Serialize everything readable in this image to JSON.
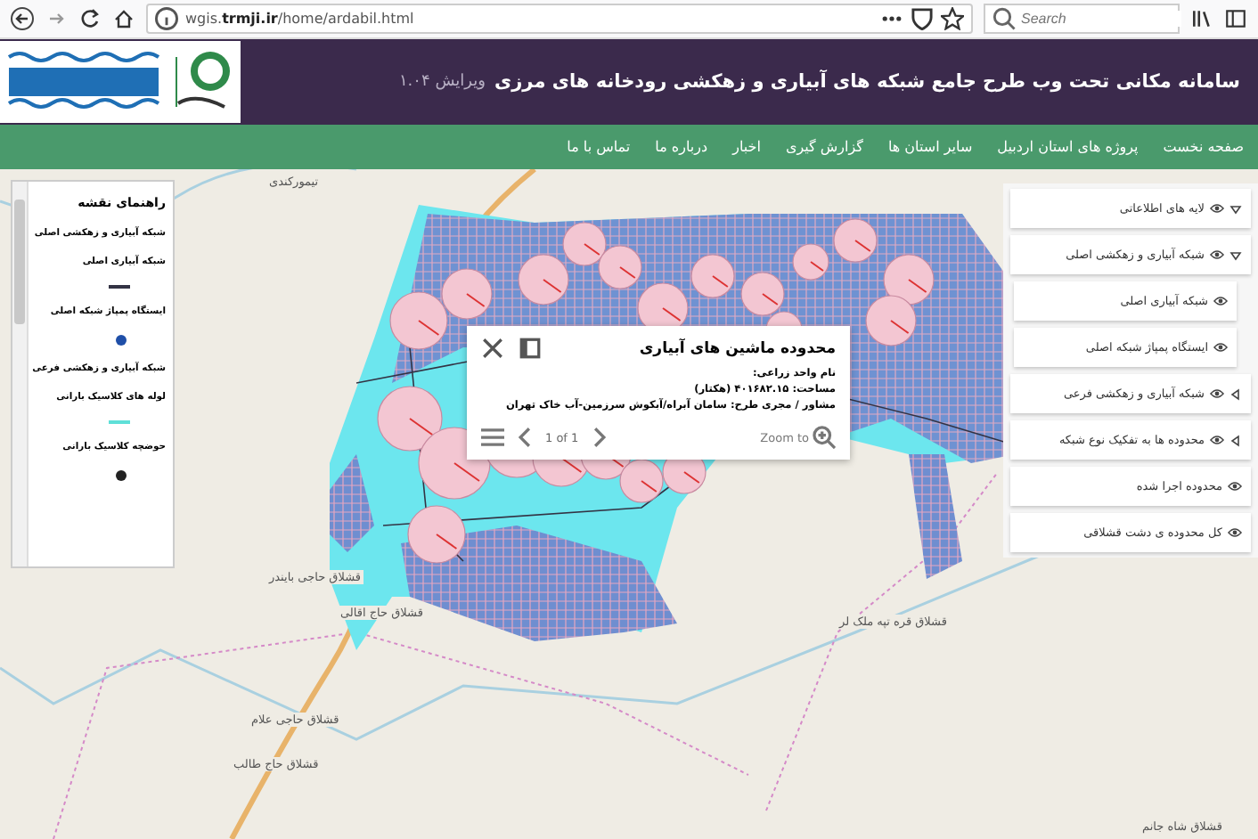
{
  "browser": {
    "url_prefix": "wgis.",
    "url_domain": "trmji.ir",
    "url_path": "/home/ardabil.html",
    "search_placeholder": "Search"
  },
  "header": {
    "title": "سامانه مکانی تحت وب طرح جامع شبکه های آبیاری و زهکشی رودخانه های مرزی",
    "version": "ویرایش ۱.۰۴"
  },
  "nav": [
    {
      "label": "صفحه نخست"
    },
    {
      "label": "پروژه های استان اردبیل"
    },
    {
      "label": "سایر استان ها"
    },
    {
      "label": "گزارش گیری"
    },
    {
      "label": "اخبار"
    },
    {
      "label": "درباره ما"
    },
    {
      "label": "تماس با ما"
    }
  ],
  "legend": {
    "title": "راهنمای نقشه",
    "items": [
      {
        "kind": "group",
        "label": "شبکه آبیاری و زهکشی اصلی"
      },
      {
        "kind": "label",
        "label": "شبکه آبیاری اصلی"
      },
      {
        "kind": "line",
        "color": "#333344"
      },
      {
        "kind": "label",
        "label": "ایستگاه پمپاژ شبکه اصلی"
      },
      {
        "kind": "point",
        "color": "#1f4fa8"
      },
      {
        "kind": "group",
        "label": "شبکه آبیاری و زهکشی فرعی"
      },
      {
        "kind": "label",
        "label": "لوله های کلاسیک بارانی"
      },
      {
        "kind": "line",
        "color": "#5fe0d8"
      },
      {
        "kind": "label",
        "label": "حوضچه کلاسیک بارانی"
      },
      {
        "kind": "point",
        "color": "#222222"
      }
    ]
  },
  "layers": [
    {
      "label": "لایه های اطلاعاتی",
      "expanded": true,
      "children": [
        {
          "label": "شبکه آبیاری و زهکشی اصلی",
          "expanded": true,
          "children": [
            {
              "label": "شبکه آبیاری اصلی"
            },
            {
              "label": "ایستگاه پمپاژ شبکه اصلی"
            }
          ]
        },
        {
          "label": "شبکه آبیاری و زهکشی فرعی",
          "expanded": false
        },
        {
          "label": "محدوده ها به تفکیک نوع شبکه",
          "expanded": false
        },
        {
          "label": "محدوده اجرا شده"
        },
        {
          "label": "کل محدوده ی دشت قشلاقی"
        }
      ]
    }
  ],
  "popup": {
    "title": "محدوده ماشین های آبیاری",
    "fields": [
      "نام واحد زراعی:",
      "مساحت: ۴۰۱۶۸۲.۱۵ (هکتار)",
      "مشاور / مجری طرح: سامان آبراه/آبکوش سرزمین-آب خاک تهران"
    ],
    "pager": "1 of 1",
    "zoom_label": "Zoom to"
  },
  "map": {
    "labels": [
      "تیمورکندی",
      "قشلاق حاجی بایندر",
      "قشلاق حاج اقالی",
      "قشلاق قره تپه ملک لر",
      "قشلاق حاجی علام",
      "قشلاق حاج طالب",
      "قشلاق شاه جانم"
    ]
  }
}
